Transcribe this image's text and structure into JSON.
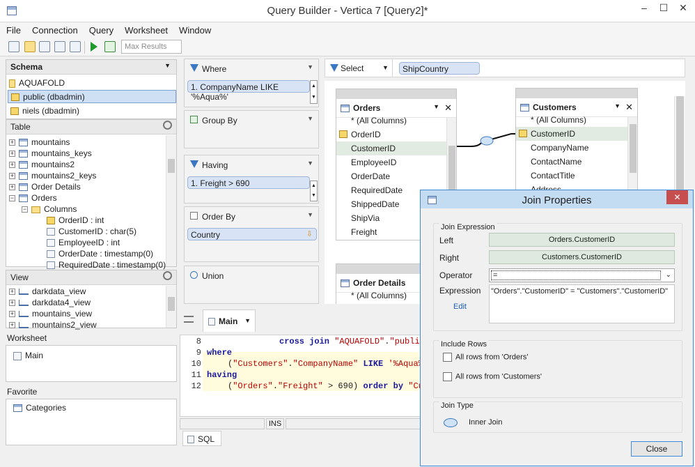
{
  "window": {
    "title": "Query Builder - Vertica 7 [Query2]*",
    "minimize": "–",
    "maximize": "☐",
    "close": "✕"
  },
  "menu": [
    "File",
    "Connection",
    "Query",
    "Worksheet",
    "Window"
  ],
  "toolbar": {
    "max_results_placeholder": "Max Results"
  },
  "schema": {
    "header": "Schema",
    "database": "AQUAFOLD",
    "items": [
      "public (dbadmin)",
      "niels (dbadmin)"
    ]
  },
  "table_panel": {
    "header": "Table",
    "rows": [
      {
        "label": "mountains",
        "kind": "table"
      },
      {
        "label": "mountains_keys",
        "kind": "table"
      },
      {
        "label": "mountains2",
        "kind": "table"
      },
      {
        "label": "mountains2_keys",
        "kind": "table"
      },
      {
        "label": "Order Details",
        "kind": "table"
      },
      {
        "label": "Orders",
        "kind": "table"
      },
      {
        "label": "Columns",
        "kind": "folder"
      },
      {
        "label": "OrderID : int",
        "kind": "key"
      },
      {
        "label": "CustomerID : char(5)",
        "kind": "column"
      },
      {
        "label": "EmployeeID : int",
        "kind": "column"
      },
      {
        "label": "OrderDate : timestamp(0)",
        "kind": "column"
      },
      {
        "label": "RequiredDate : timestamp(0)",
        "kind": "column"
      }
    ]
  },
  "view_panel": {
    "header": "View",
    "rows": [
      "darkdata_view",
      "darkdata4_view",
      "mountains_view",
      "mountains2_view"
    ]
  },
  "worksheet_panel": {
    "header": "Worksheet",
    "items": [
      "Main"
    ]
  },
  "favorite_panel": {
    "header": "Favorite",
    "items": [
      "Categories"
    ]
  },
  "clauses": {
    "where": {
      "label": "Where",
      "item": "1. CompanyName LIKE '%Aqua%'"
    },
    "group_by": {
      "label": "Group By"
    },
    "having": {
      "label": "Having",
      "item": "1. Freight > 690"
    },
    "order_by": {
      "label": "Order By",
      "item": "Country"
    },
    "union": {
      "label": "Union"
    }
  },
  "select": {
    "label": "Select",
    "field": "ShipCountry"
  },
  "diagram": {
    "orders": {
      "name": "Orders",
      "fields": [
        "* (All Columns)",
        "OrderID",
        "CustomerID",
        "EmployeeID",
        "OrderDate",
        "RequiredDate",
        "ShippedDate",
        "ShipVia",
        "Freight"
      ]
    },
    "customers": {
      "name": "Customers",
      "fields": [
        "* (All Columns)",
        "CustomerID",
        "CompanyName",
        "ContactName",
        "ContactTitle",
        "Address"
      ]
    },
    "order_details": {
      "name": "Order Details",
      "fields": [
        "* (All Columns)"
      ]
    }
  },
  "editor": {
    "tab": "Main",
    "lines": [
      {
        "n": "8",
        "code": "cross join \"AQUAFOLD\".\"publi"
      },
      {
        "n": "9",
        "code": "where"
      },
      {
        "n": "10",
        "code": "(\"Customers\".\"CompanyName\" LIKE '%Aqua%'"
      },
      {
        "n": "11",
        "code": "having"
      },
      {
        "n": "12",
        "code": "(\"Orders\".\"Freight\" > 690) order by \"Cus"
      }
    ],
    "status_ins": "INS",
    "bottom_tab": "SQL"
  },
  "dialog": {
    "title": "Join Properties",
    "join_expression": "Join Expression",
    "left_label": "Left",
    "left_value": "Orders.CustomerID",
    "right_label": "Right",
    "right_value": "Customers.CustomerID",
    "operator_label": "Operator",
    "operator_value": "=",
    "expression_label": "Expression",
    "expression_value": "\"Orders\".\"CustomerID\" = \"Customers\".\"CustomerID\"",
    "edit_link": "Edit",
    "include_rows": "Include Rows",
    "all_orders": "All rows from 'Orders'",
    "all_customers": "All rows from 'Customers'",
    "join_type": "Join Type",
    "join_type_value": "Inner Join",
    "close_button": "Close"
  }
}
